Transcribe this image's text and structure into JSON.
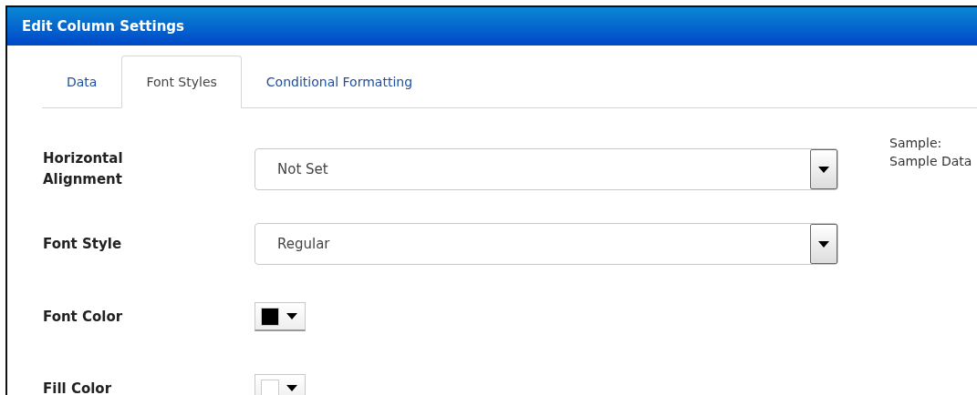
{
  "window": {
    "title": "Edit Column Settings"
  },
  "tabs": [
    {
      "label": "Data",
      "selected": false
    },
    {
      "label": "Font Styles",
      "selected": true
    },
    {
      "label": "Conditional Formatting",
      "selected": false
    }
  ],
  "fields": [
    {
      "kind": "select",
      "label": "Horizontal Alignment",
      "value": "Not Set"
    },
    {
      "kind": "select",
      "label": "Font Style",
      "value": "Regular"
    },
    {
      "kind": "color",
      "label": "Font Color",
      "color": "#000000"
    },
    {
      "kind": "color",
      "label": "Fill Color",
      "color": "#ffffff"
    }
  ],
  "sample": {
    "label": "Sample:",
    "text": "Sample Data"
  }
}
